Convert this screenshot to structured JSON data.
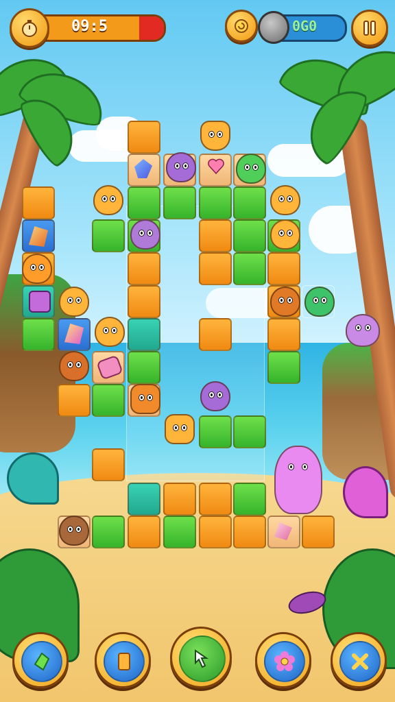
{
  "hud": {
    "timer": "09:5",
    "timer_fill": 0.78,
    "score": "0G0",
    "icons": {
      "left": "stopwatch-icon",
      "coin": "coin-icon",
      "gem_bag": "bag-icon",
      "pause": "pause-icon"
    }
  },
  "colors": {
    "orange_tile": "#f5a024",
    "green_tile": "#4ccc36",
    "timer_bar": "#f39a1a",
    "timer_alert": "#e22a22",
    "score_bar": "#2a8fd6",
    "hud_gold": "#f6b928"
  },
  "controls": [
    {
      "name": "gem-tool-button",
      "icon": "green-gem-icon"
    },
    {
      "name": "card-tool-button",
      "icon": "orange-card-icon"
    },
    {
      "name": "cursor-tool-button",
      "icon": "arrow-cursor-icon"
    },
    {
      "name": "flower-tool-button",
      "icon": "flower-icon"
    },
    {
      "name": "close-button",
      "icon": "x-icon"
    }
  ]
}
